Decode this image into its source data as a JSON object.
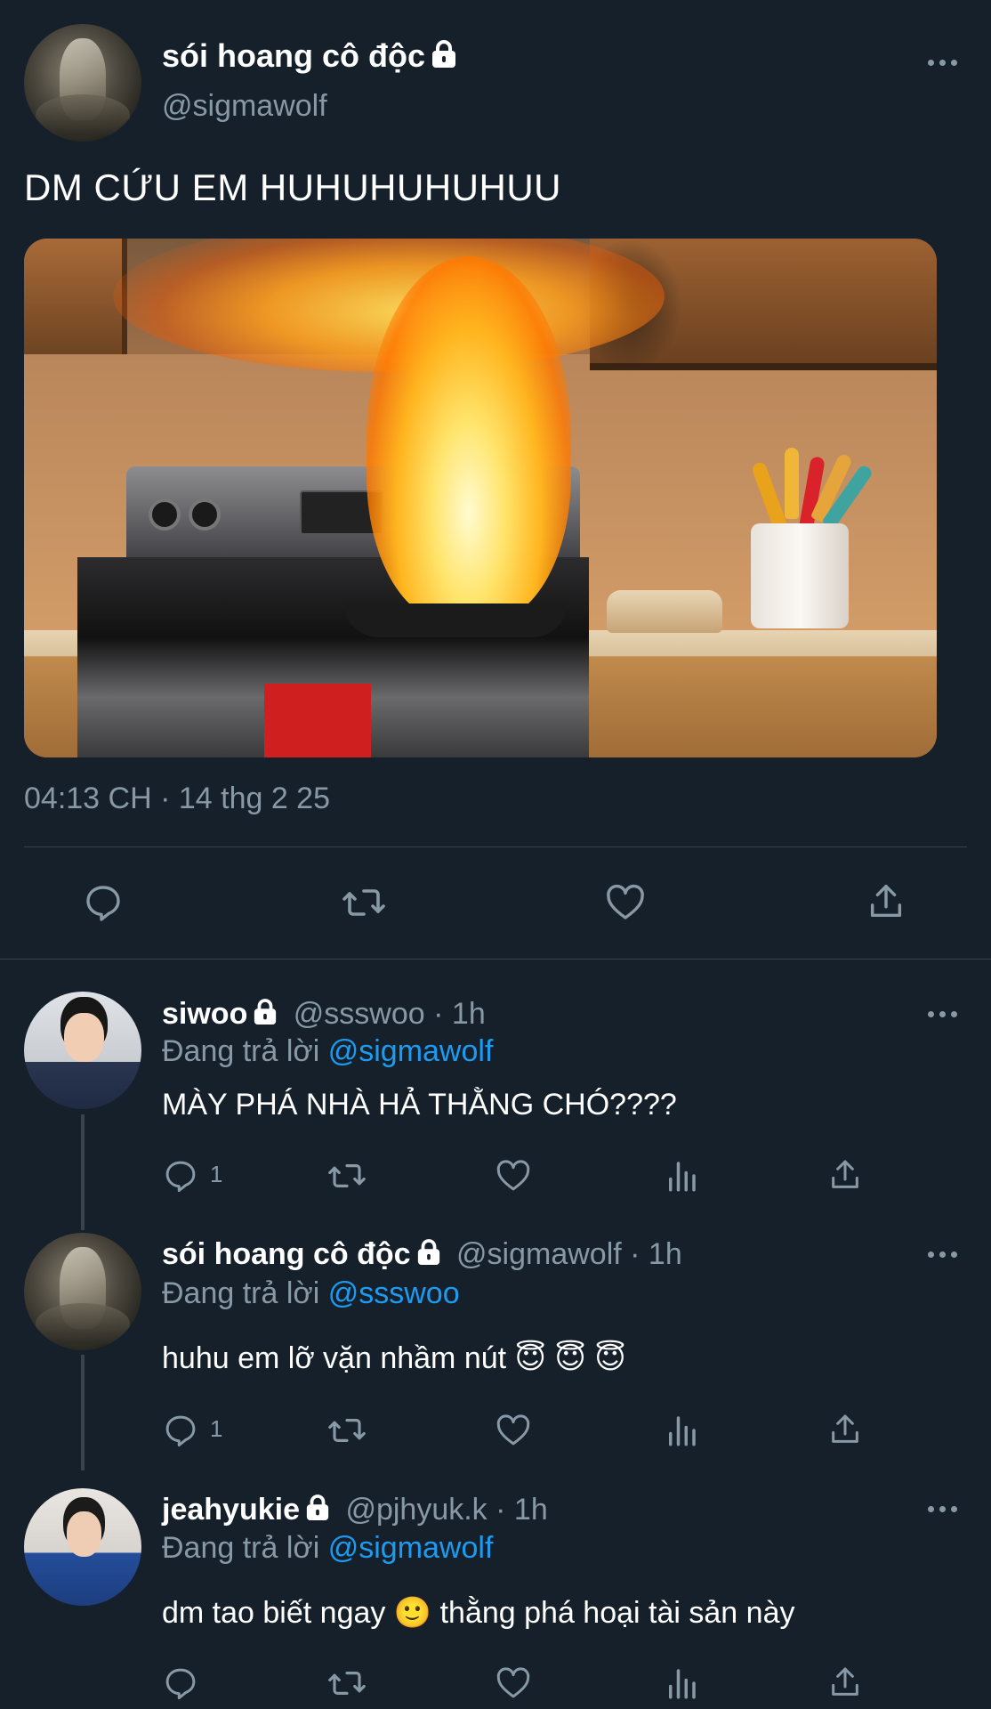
{
  "main_tweet": {
    "display_name": "sói hoang cô độc",
    "handle": "@sigmawolf",
    "text": "DM CỨU EM HUHUHUHUHUU",
    "timestamp": "04:13 CH · 14 thg 2 25"
  },
  "replies": [
    {
      "display_name": "siwoo",
      "handle": "@ssswoo",
      "time": "· 1h",
      "replying_prefix": "Đang trả lời",
      "replying_to": "@sigmawolf",
      "text": "MÀY PHÁ NHÀ HẢ THẰNG CHÓ????",
      "reply_count": "1"
    },
    {
      "display_name": "sói hoang cô độc",
      "handle": "@sigmawolf",
      "time": "· 1h",
      "replying_prefix": "Đang trả lời",
      "replying_to": "@ssswoo",
      "text": "huhu em lỡ vặn nhầm nút 😇 😇 😇",
      "reply_count": "1"
    },
    {
      "display_name": "jeahyukie",
      "handle": "@pjhyuk.k",
      "time": "· 1h",
      "replying_prefix": "Đang trả lời",
      "replying_to": "@sigmawolf",
      "text": "dm tao biết ngay 🙂 thằng phá hoại tài sản này",
      "reply_count": ""
    }
  ],
  "colors": {
    "background": "#15202b",
    "secondary_text": "#8899a6",
    "link": "#1d9bf0",
    "divider": "#38444d"
  },
  "icons": [
    "lock-icon",
    "more-icon",
    "reply-icon",
    "retweet-icon",
    "like-icon",
    "share-icon",
    "analytics-icon"
  ]
}
